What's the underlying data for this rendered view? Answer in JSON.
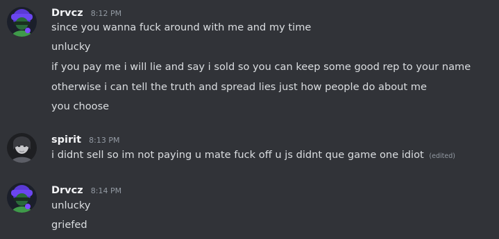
{
  "theme": {
    "background": "#313338",
    "username_color": "#f2f3f5",
    "message_color": "#dbdee1",
    "muted_color": "#949ba4"
  },
  "groups": [
    {
      "username": "Drvcz",
      "timestamp": "8:12 PM",
      "avatar": "masked-purple-avatar-icon",
      "messages": [
        "since you wanna fuck around with me and my time",
        "unlucky",
        "if you pay me i will lie and say i sold so you can keep some good rep to your name",
        "otherwise i can tell the truth and spread lies just how people do about me",
        "you choose"
      ]
    },
    {
      "username": "spirit",
      "timestamp": "8:13 PM",
      "avatar": "grayscale-portrait-avatar-icon",
      "messages": [
        "i didnt sell so im not paying u mate fuck off u js didnt que game one idiot"
      ],
      "edited_label": "(edited)"
    },
    {
      "username": "Drvcz",
      "timestamp": "8:14 PM",
      "avatar": "masked-purple-avatar-icon",
      "messages": [
        "unlucky",
        "griefed"
      ]
    }
  ]
}
